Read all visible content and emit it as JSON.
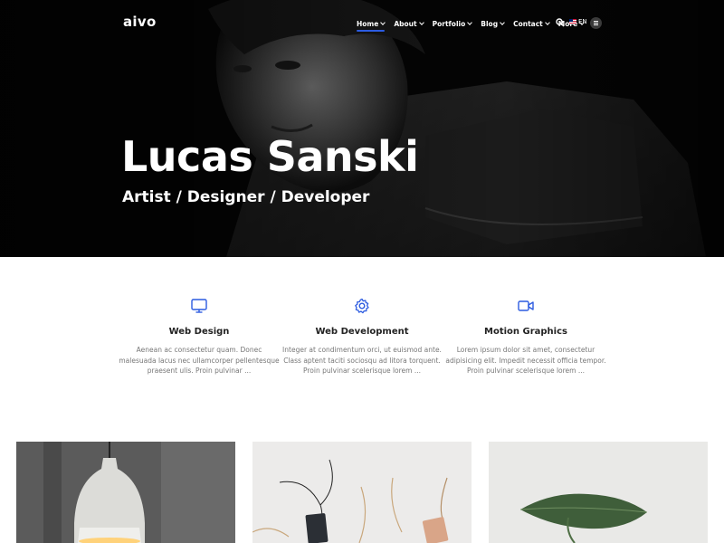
{
  "header": {
    "logo": "aivo",
    "menu": [
      {
        "label": "Home",
        "active": true
      },
      {
        "label": "About",
        "active": false
      },
      {
        "label": "Portfolio",
        "active": false
      },
      {
        "label": "Blog",
        "active": false
      },
      {
        "label": "Contact",
        "active": false
      },
      {
        "label": "More",
        "active": false
      }
    ],
    "language": "EN",
    "accent_color": "#2c5be0"
  },
  "hero": {
    "title": "Lucas Sanski",
    "subtitle": "Artist / Designer / Developer"
  },
  "services": [
    {
      "icon": "monitor-icon",
      "title": "Web Design",
      "text": "Aenean ac consectetur quam. Donec malesuada lacus nec ullamcorper pellentesque praesent ulis. Proin pulvinar ..."
    },
    {
      "icon": "gear-icon",
      "title": "Web Development",
      "text": "Integer at condimentum orci, ut euismod ante. Class aptent taciti sociosqu ad litora torquent. Proin pulvinar scelerisque lorem ..."
    },
    {
      "icon": "video-camera-icon",
      "title": "Motion Graphics",
      "text": "Lorem ipsum dolor sit amet, consectetur adipisicing elit. Impedit necessit officia tempor. Proin pulvinar scelerisque lorem ..."
    }
  ],
  "gallery": [
    {
      "image": "pendant-lamp-photo"
    },
    {
      "image": "hang-tags-photo"
    },
    {
      "image": "green-leaf-photo"
    }
  ]
}
